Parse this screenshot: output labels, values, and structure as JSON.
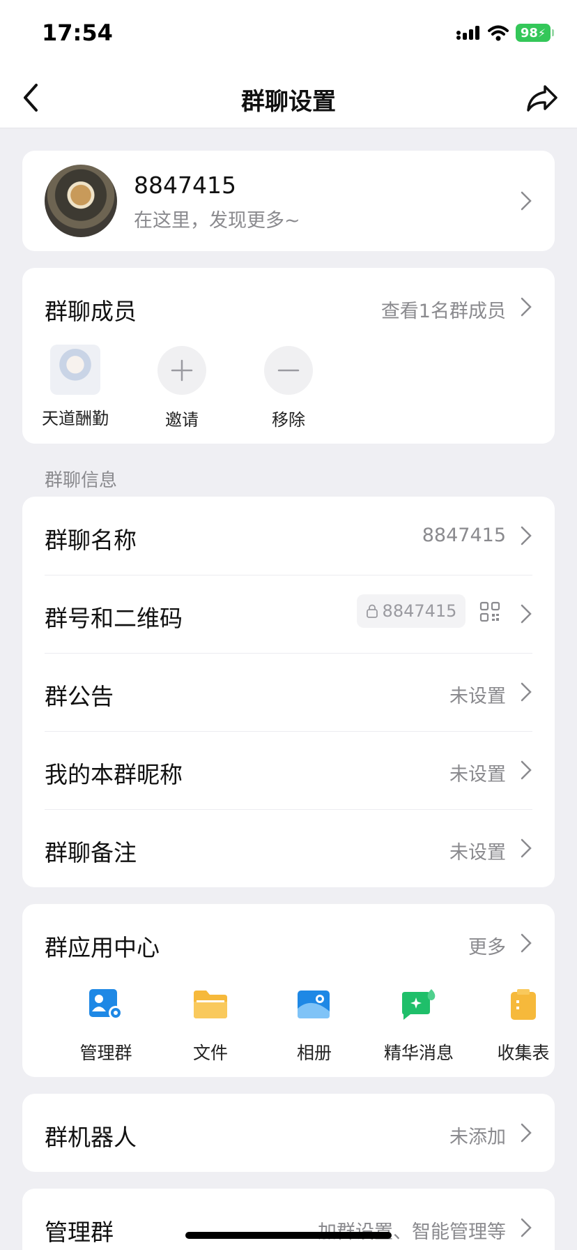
{
  "status": {
    "time": "17:54",
    "battery": "98"
  },
  "nav": {
    "title": "群聊设置"
  },
  "header": {
    "name": "8847415",
    "subtitle": "在这里，发现更多~"
  },
  "members": {
    "title": "群聊成员",
    "link": "查看1名群成员",
    "items": [
      {
        "name": "天道酬勤"
      },
      {
        "name": "邀请"
      },
      {
        "name": "移除"
      }
    ]
  },
  "info": {
    "section_label": "群聊信息",
    "rows": [
      {
        "label": "群聊名称",
        "value": "8847415"
      },
      {
        "label": "群号和二维码",
        "value": "8847415"
      },
      {
        "label": "群公告",
        "value": "未设置"
      },
      {
        "label": "我的本群昵称",
        "value": "未设置"
      },
      {
        "label": "群聊备注",
        "value": "未设置"
      }
    ]
  },
  "apps": {
    "title": "群应用中心",
    "more": "更多",
    "items": [
      {
        "label": "管理群",
        "icon": "manage-group-icon",
        "color": "#1e88e5"
      },
      {
        "label": "文件",
        "icon": "folder-icon",
        "color": "#f6b93b"
      },
      {
        "label": "相册",
        "icon": "album-icon",
        "color": "#1e88e5"
      },
      {
        "label": "精华消息",
        "icon": "essence-message-icon",
        "color": "#1fbf6a"
      },
      {
        "label": "收集表",
        "icon": "form-icon",
        "color": "#f6b93b"
      }
    ]
  },
  "robot": {
    "label": "群机器人",
    "value": "未添加"
  },
  "manage": {
    "label": "管理群",
    "value": "加群设置、智能管理等"
  }
}
